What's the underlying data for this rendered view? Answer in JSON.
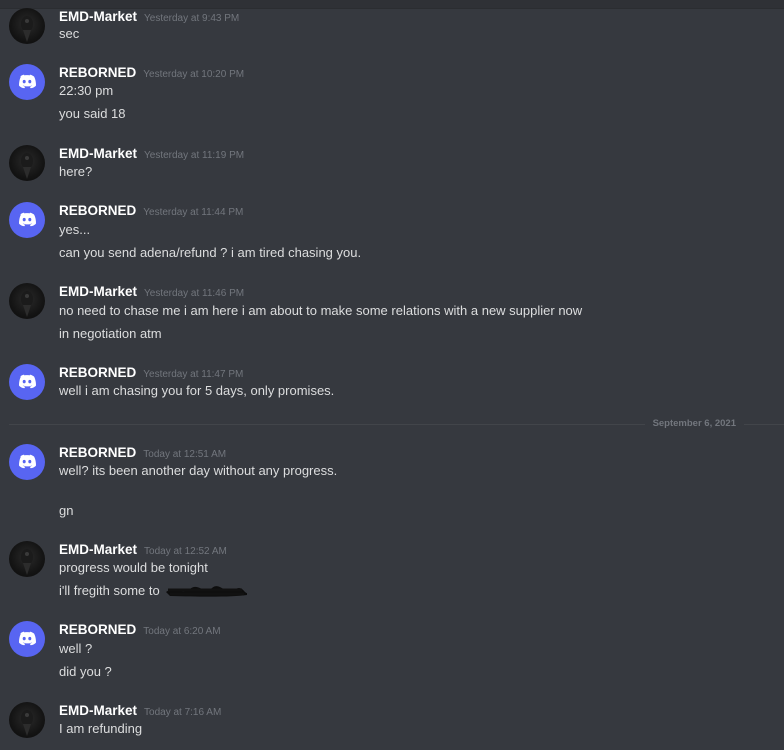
{
  "date_divider": "September 6, 2021",
  "messages": [
    {
      "user": "EMD-Market",
      "avatar": "emd",
      "time": "Yesterday at 9:43 PM",
      "lines": [
        "sec"
      ]
    },
    {
      "user": "REBORNED",
      "avatar": "reb",
      "time": "Yesterday at 10:20 PM",
      "lines": [
        "22:30 pm",
        "you said 18"
      ]
    },
    {
      "user": "EMD-Market",
      "avatar": "emd",
      "time": "Yesterday at 11:19 PM",
      "lines": [
        "here?"
      ]
    },
    {
      "user": "REBORNED",
      "avatar": "reb",
      "time": "Yesterday at 11:44 PM",
      "lines": [
        "yes...",
        "can you send adena/refund ? i am tired chasing you."
      ]
    },
    {
      "user": "EMD-Market",
      "avatar": "emd",
      "time": "Yesterday at 11:46 PM",
      "lines": [
        "no need to chase me i am here i am about to make some relations with a new supplier now",
        "in negotiation atm"
      ]
    },
    {
      "user": "REBORNED",
      "avatar": "reb",
      "time": "Yesterday at 11:47 PM",
      "lines": [
        "well i am chasing you for 5 days, only promises."
      ]
    },
    {
      "user": "REBORNED",
      "avatar": "reb",
      "time": "Today at 12:51 AM",
      "lines": [
        "well? its been another day without any progress.",
        "gn"
      ]
    },
    {
      "user": "EMD-Market",
      "avatar": "emd",
      "time": "Today at 12:52 AM",
      "lines": [
        "progress would be tonight",
        "i'll fregith some to"
      ]
    },
    {
      "user": "REBORNED",
      "avatar": "reb",
      "time": "Today at 6:20 AM",
      "lines": [
        "well ?",
        "did you ?"
      ]
    },
    {
      "user": "EMD-Market",
      "avatar": "emd",
      "time": "Today at 7:16 AM",
      "lines": [
        "I am refunding"
      ]
    }
  ]
}
